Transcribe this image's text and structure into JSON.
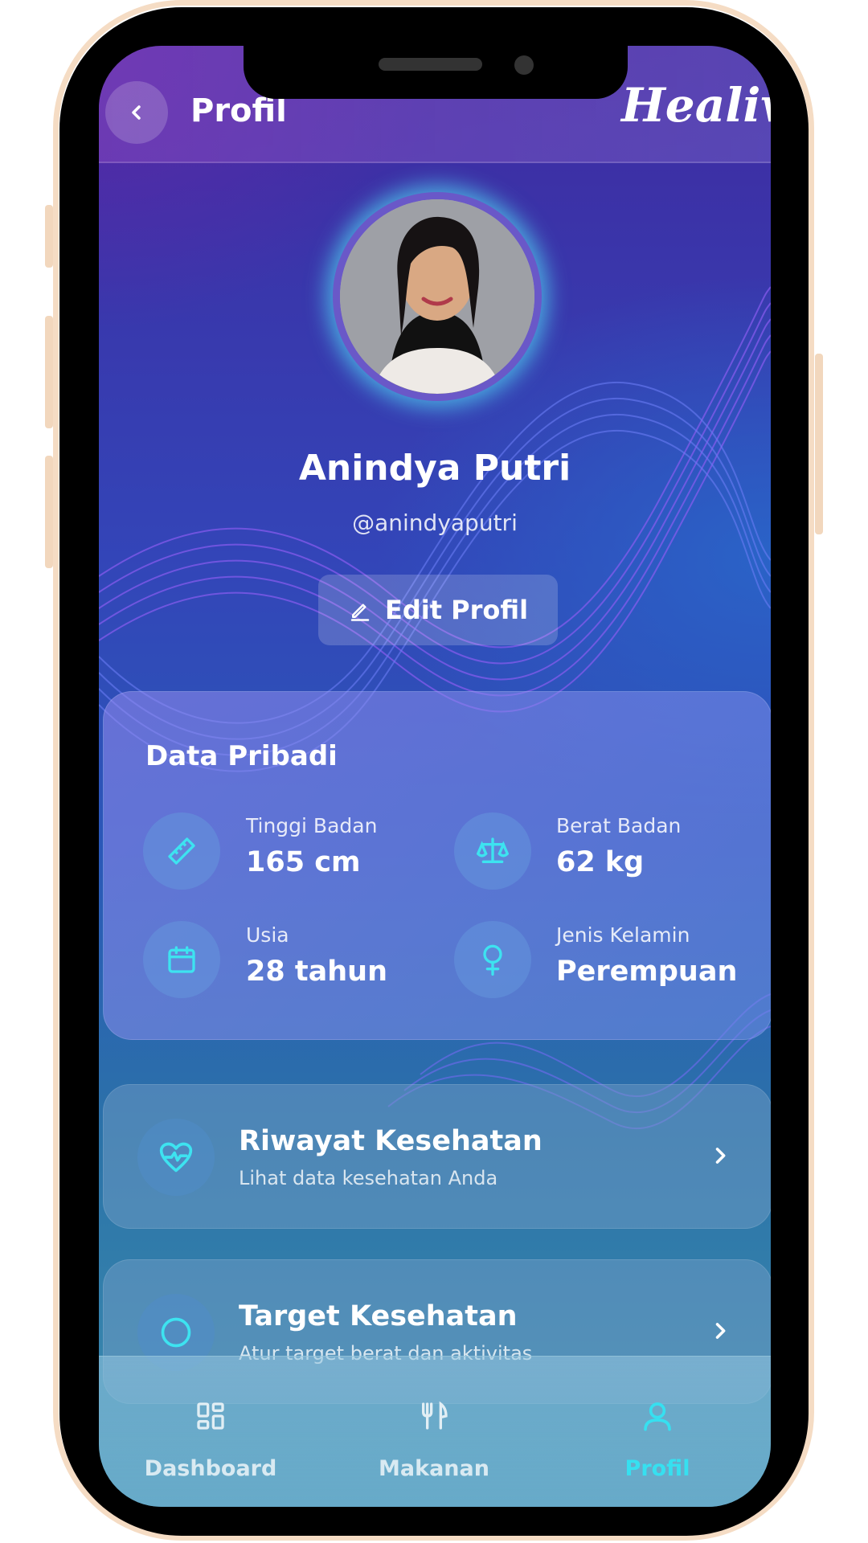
{
  "header": {
    "title": "Profil",
    "logo": "Healive"
  },
  "profile": {
    "name": "Anindya Putri",
    "username": "@anindyaputri",
    "edit_label": "Edit Profil"
  },
  "personal_data": {
    "title": "Data Pribadi",
    "items": [
      {
        "label": "Tinggi Badan",
        "value": "165 cm",
        "icon": "ruler-icon"
      },
      {
        "label": "Berat Badan",
        "value": "62 kg",
        "icon": "scale-icon"
      },
      {
        "label": "Usia",
        "value": "28 tahun",
        "icon": "calendar-icon"
      },
      {
        "label": "Jenis Kelamin",
        "value": "Perempuan",
        "icon": "female-icon"
      }
    ]
  },
  "menu": [
    {
      "title": "Riwayat Kesehatan",
      "subtitle": "Lihat data kesehatan Anda",
      "icon": "heart-pulse-icon"
    },
    {
      "title": "Target Kesehatan",
      "subtitle": "Atur target berat dan aktivitas",
      "icon": "target-icon"
    }
  ],
  "nav": [
    {
      "label": "Dashboard",
      "icon": "grid-icon"
    },
    {
      "label": "Makanan",
      "icon": "utensils-icon"
    },
    {
      "label": "Profil",
      "icon": "user-icon",
      "active": true
    }
  ],
  "colors": {
    "accent": "#36e0f0",
    "frame": "#f5dcc4"
  }
}
